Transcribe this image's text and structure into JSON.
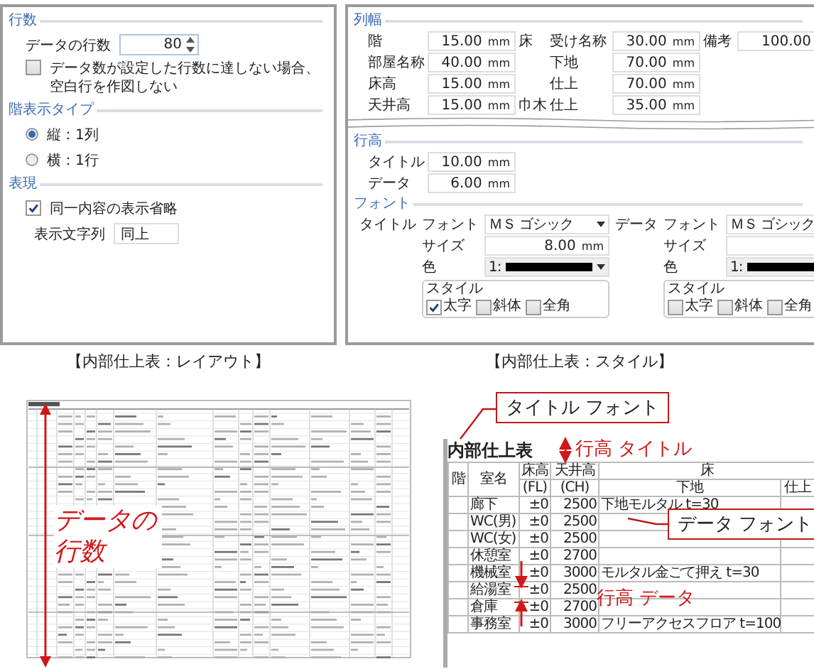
{
  "layout_panel": {
    "row_count": {
      "heading": "行数",
      "label": "データの行数",
      "value": "80",
      "no_blank_rows": {
        "label": "データ数が設定した行数に達しない場合、空白行を作図しない",
        "checked": false
      }
    },
    "floor_display_type": {
      "heading": "階表示タイプ",
      "options": [
        {
          "label": "縦：1列",
          "selected": true
        },
        {
          "label": "横：1行",
          "selected": false
        }
      ]
    },
    "expression": {
      "heading": "表現",
      "omit_same": {
        "label": "同一内容の表示省略",
        "checked": true
      },
      "display_string": {
        "label": "表示文字列",
        "value": "同上"
      }
    },
    "caption": "【内部仕上表：レイアウト】"
  },
  "style_panel": {
    "column_width": {
      "heading": "列幅",
      "rows": [
        [
          {
            "label": "階",
            "value": "15.00",
            "unit": "mm"
          },
          {
            "group": "床",
            "label": "受け名称",
            "value": "30.00",
            "unit": "mm"
          },
          {
            "label": "備考",
            "value": "100.00"
          }
        ],
        [
          {
            "label": "部屋名称",
            "value": "40.00",
            "unit": "mm"
          },
          {
            "label": "下地",
            "value": "70.00",
            "unit": "mm"
          }
        ],
        [
          {
            "label": "床高",
            "value": "15.00",
            "unit": "mm"
          },
          {
            "label": "仕上",
            "value": "70.00",
            "unit": "mm"
          }
        ],
        [
          {
            "label": "天井高",
            "value": "15.00",
            "unit": "mm"
          },
          {
            "group": "巾木",
            "label": "仕上",
            "value": "35.00",
            "unit": "mm"
          }
        ]
      ]
    },
    "row_height": {
      "heading": "行高",
      "rows": [
        {
          "label": "タイトル",
          "value": "10.00",
          "unit": "mm"
        },
        {
          "label": "データ",
          "value": "6.00",
          "unit": "mm"
        }
      ]
    },
    "font": {
      "heading": "フォント",
      "groups": [
        {
          "label": "タイトル",
          "font_label": "フォント",
          "font": "ＭＳ ゴシック",
          "size_label": "サイズ",
          "size": "8.00",
          "size_unit": "mm",
          "color_label": "色",
          "color_index": "1:",
          "color": "#000000",
          "style_heading": "スタイル",
          "styles": [
            {
              "label": "太字",
              "checked": true
            },
            {
              "label": "斜体",
              "checked": false
            },
            {
              "label": "全角",
              "checked": false
            }
          ]
        },
        {
          "label": "データ",
          "font_label": "フォント",
          "font": "ＭＳ ゴシック",
          "size_label": "サイズ",
          "color_label": "色",
          "color_index": "1:",
          "color": "#000000",
          "style_heading": "スタイル",
          "styles": [
            {
              "label": "太字",
              "checked": false
            },
            {
              "label": "斜体",
              "checked": false
            },
            {
              "label": "全角",
              "checked": false
            }
          ]
        }
      ]
    },
    "caption": "【内部仕上表：スタイル】"
  },
  "preview": {
    "title": "内部仕上表",
    "header": {
      "floor": "階",
      "room": "室名",
      "fl": "床高",
      "fl_unit": "(FL)",
      "ch": "天井高",
      "ch_unit": "(CH)",
      "floor_group": "床",
      "base": "下地",
      "finish": "仕上"
    },
    "rows": [
      {
        "room": "廊下",
        "fl": "±0",
        "ch": "2500",
        "base": "下地モルタル t=30"
      },
      {
        "room": "WC(男)",
        "fl": "±0",
        "ch": "2500"
      },
      {
        "room": "WC(女)",
        "fl": "±0",
        "ch": "2500"
      },
      {
        "room": "休憩室",
        "fl": "±0",
        "ch": "2700"
      },
      {
        "room": "機械室",
        "fl": "±0",
        "ch": "3000",
        "base": "モルタル金ごて押え t=30"
      },
      {
        "room": "給湯室",
        "fl": "±0",
        "ch": "2500"
      },
      {
        "room": "倉庫",
        "fl": "±0",
        "ch": "2700"
      },
      {
        "room": "事務室",
        "fl": "±0",
        "ch": "3000",
        "base": "フリーアクセスフロア t=100"
      }
    ]
  },
  "annotations": {
    "row_count": "データの行数",
    "title_font": "タイトル フォント",
    "title_row_height": "行高 タイトル",
    "data_font": "データ フォント",
    "data_row_height": "行高 データ"
  }
}
